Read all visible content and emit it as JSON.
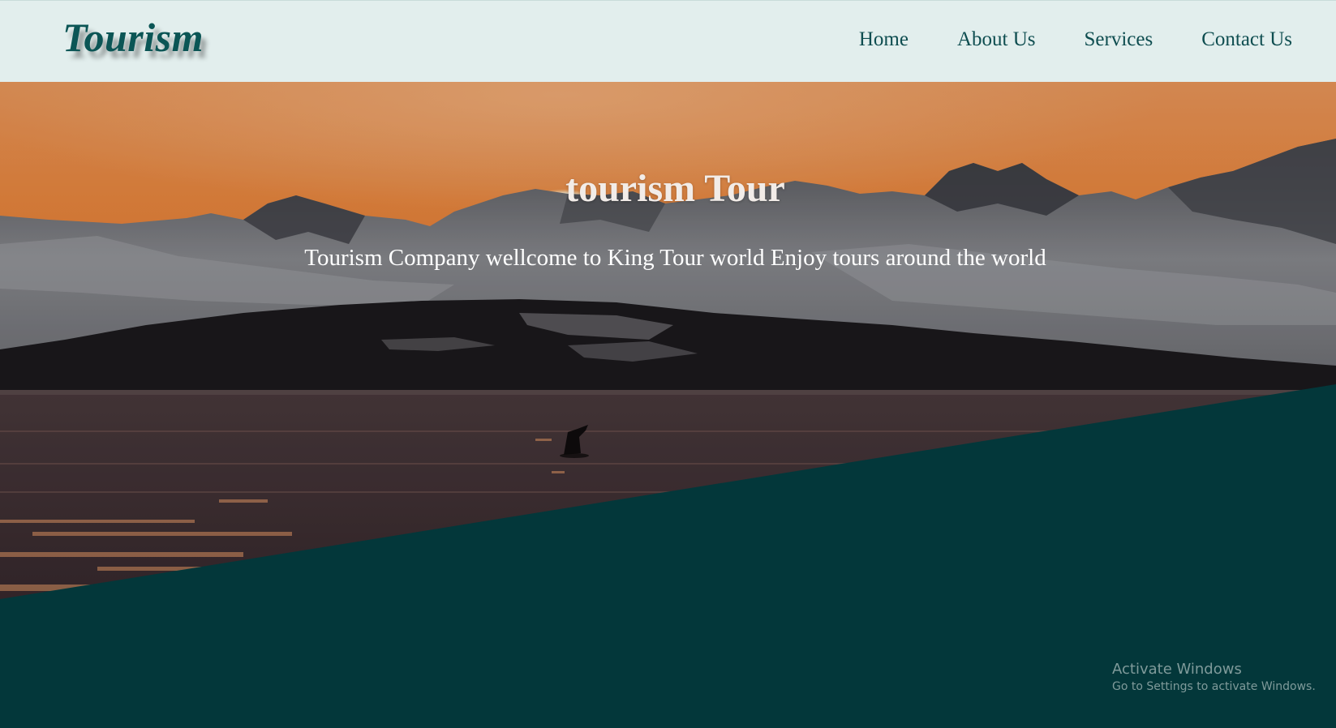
{
  "header": {
    "logo": "Tourism",
    "nav": [
      {
        "label": "Home"
      },
      {
        "label": "About Us"
      },
      {
        "label": "Services"
      },
      {
        "label": "Contact Us"
      }
    ]
  },
  "hero": {
    "title": "tourism Tour",
    "subtitle": "Tourism Company wellcome to King Tour world Enjoy tours around the world"
  },
  "watermark": {
    "line1": "Activate Windows",
    "line2": "Go to Settings to activate Windows."
  },
  "colors": {
    "header_bg": "#e2eeed",
    "brand": "#0b5555",
    "dark_teal": "#03373a"
  }
}
